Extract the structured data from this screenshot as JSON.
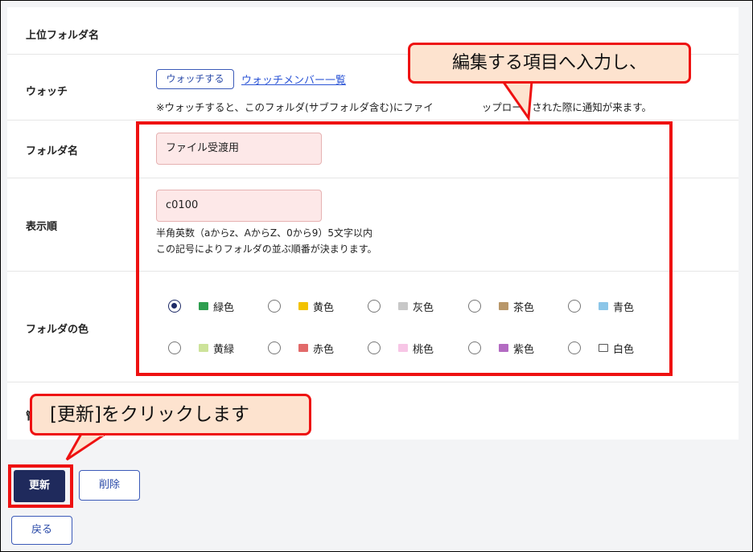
{
  "form": {
    "parent_folder_label": "上位フォルダ名",
    "watch_label": "ウォッチ",
    "watch_button": "ウォッチする",
    "watch_members_link": "ウォッチメンバー一覧",
    "watch_note": "※ウォッチすると、このフォルダ(サブフォルダ含む)にファイ",
    "watch_note_tail": "ップロードされた際に通知が来ます。",
    "folder_name_label": "フォルダ名",
    "folder_name_value": "ファイル受渡用",
    "order_label": "表示順",
    "order_value": "c0100",
    "order_help_1": "半角英数（aからz、AからZ、0から9）5文字以内",
    "order_help_2": "この記号によりフォルダの並ぶ順番が決まります。",
    "color_label": "フォルダの色",
    "hidden_row_partial": "管",
    "colors": [
      {
        "label": "緑色",
        "swatch": "#2e9e4f",
        "selected": true
      },
      {
        "label": "黄色",
        "swatch": "#f2c200",
        "selected": false
      },
      {
        "label": "灰色",
        "swatch": "#c8c8c8",
        "selected": false
      },
      {
        "label": "茶色",
        "swatch": "#b8976a",
        "selected": false
      },
      {
        "label": "青色",
        "swatch": "#8cc6e8",
        "selected": false
      },
      {
        "label": "黄緑",
        "swatch": "#cde39a",
        "selected": false
      },
      {
        "label": "赤色",
        "swatch": "#e26a6a",
        "selected": false
      },
      {
        "label": "桃色",
        "swatch": "#f7c6e6",
        "selected": false
      },
      {
        "label": "紫色",
        "swatch": "#b36bc2",
        "selected": false
      },
      {
        "label": "白色",
        "swatch": "#ffffff",
        "selected": false
      }
    ]
  },
  "buttons": {
    "update": "更新",
    "delete": "削除",
    "back": "戻る"
  },
  "callouts": {
    "top": "編集する項目へ入力し、",
    "bottom": "[更新]をクリックします"
  },
  "accent": {
    "primary": "#1f2a5c",
    "annotation": "#ee1111",
    "callout_fill": "#fde3cf"
  }
}
